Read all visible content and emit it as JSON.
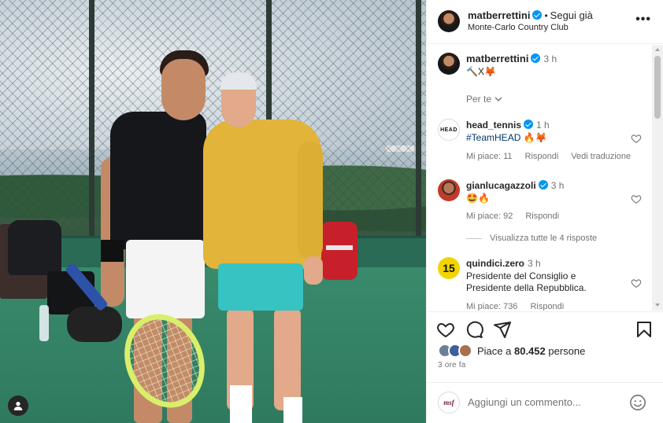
{
  "post": {
    "username": "matberrettini",
    "follow_status": "Segui già",
    "location": "Monte-Carlo Country Club",
    "more_label": "•••"
  },
  "caption": {
    "username": "matberrettini",
    "time": "3 h",
    "text": "🔨X🦊",
    "translate_label": "Per te"
  },
  "comments": [
    {
      "avatar_text": "HEAD",
      "username": "head_tennis",
      "time": "1 h",
      "text": "#TeamHEAD 🔥🦊",
      "likes": "Mi piace: 11",
      "reply": "Rispondi",
      "extra": "Vedi traduzione"
    },
    {
      "avatar_text": "",
      "username": "gianlucagazzoli",
      "time": "3 h",
      "text": "🤩🔥",
      "likes": "Mi piace: 92",
      "reply": "Rispondi",
      "view_replies": "Visualizza tutte le 4 risposte"
    },
    {
      "avatar_text": "15",
      "username": "quindici.zero",
      "time": "3 h",
      "text": "Presidente del Consiglio e Presidente della Repubblica.",
      "likes": "Mi piace: 736",
      "reply": "Rispondi"
    }
  ],
  "likes": {
    "prefix": "Piace a ",
    "count": "80.452",
    "suffix": " persone"
  },
  "time_ago": "3 ore fa",
  "add_comment": {
    "avatar_text": "msf",
    "placeholder": "Aggiungi un commento..."
  },
  "icons": {
    "like": "heart-icon",
    "comment": "comment-icon",
    "share": "share-icon",
    "save": "bookmark-icon",
    "emoji": "emoji-icon",
    "more": "more-icon",
    "tag": "user-tag-icon"
  },
  "colors": {
    "verified": "#0095f6",
    "text": "#262626",
    "secondary": "#737373"
  }
}
